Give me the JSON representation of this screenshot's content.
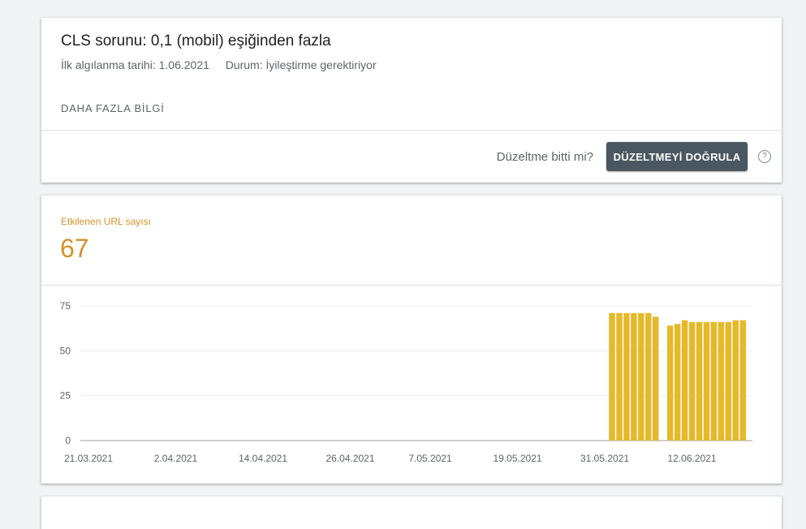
{
  "issue": {
    "title": "CLS sorunu: 0,1 (mobil) eşiğinden fazla",
    "first_detected_label": "İlk algılanma tarihi:",
    "first_detected_value": "1.06.2021",
    "status_label": "Durum:",
    "status_value": "İyileştirme gerektiriyor",
    "more_info": "DAHA FAZLA BİLGİ",
    "fix_question": "Düzeltme bitti mi?",
    "validate_button": "DÜZELTMEYİ DOĞRULA",
    "help_icon": "help-circle-icon"
  },
  "metric": {
    "label": "Etkilenen URL sayısı",
    "value": "67"
  },
  "colors": {
    "accent": "#d4922a",
    "bar": "#e6b92a",
    "button": "#4a5760"
  },
  "chart_data": {
    "type": "bar",
    "title": "",
    "xlabel": "",
    "ylabel": "",
    "ylim": [
      0,
      75
    ],
    "yticks": [
      0,
      25,
      50,
      75
    ],
    "x_tick_labels": [
      "21.03.2021",
      "2.04.2021",
      "14.04.2021",
      "26.04.2021",
      "7.05.2021",
      "19.05.2021",
      "31.05.2021",
      "12.06.2021"
    ],
    "grid": true,
    "bars": [
      {
        "date": "2021-06-01",
        "value": 71
      },
      {
        "date": "2021-06-02",
        "value": 71
      },
      {
        "date": "2021-06-03",
        "value": 71
      },
      {
        "date": "2021-06-04",
        "value": 71
      },
      {
        "date": "2021-06-05",
        "value": 71
      },
      {
        "date": "2021-06-06",
        "value": 71
      },
      {
        "date": "2021-06-07",
        "value": 69
      },
      {
        "date": "2021-06-09",
        "value": 64
      },
      {
        "date": "2021-06-10",
        "value": 65
      },
      {
        "date": "2021-06-11",
        "value": 67
      },
      {
        "date": "2021-06-12",
        "value": 66
      },
      {
        "date": "2021-06-13",
        "value": 66
      },
      {
        "date": "2021-06-14",
        "value": 66
      },
      {
        "date": "2021-06-15",
        "value": 66
      },
      {
        "date": "2021-06-16",
        "value": 66
      },
      {
        "date": "2021-06-17",
        "value": 66
      },
      {
        "date": "2021-06-18",
        "value": 67
      },
      {
        "date": "2021-06-19",
        "value": 67
      }
    ]
  }
}
